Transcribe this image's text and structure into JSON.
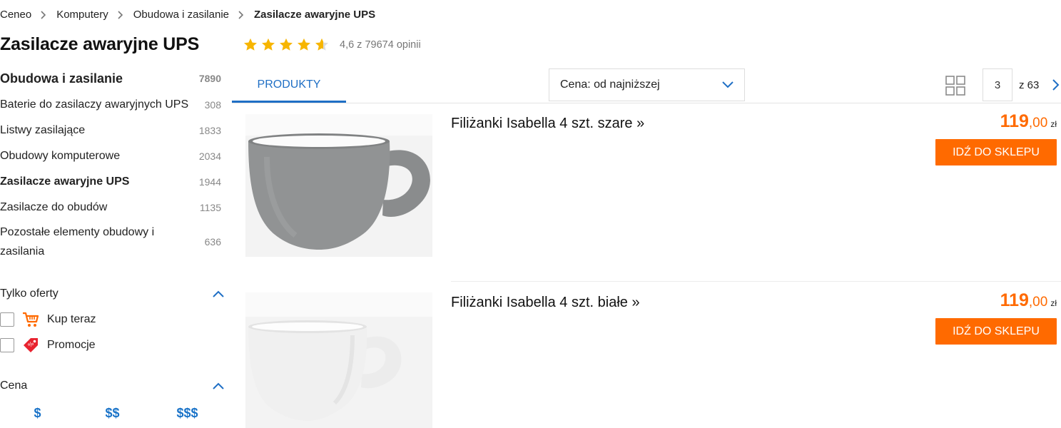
{
  "breadcrumb": {
    "items": [
      "Ceneo",
      "Komputery",
      "Obudowa i zasilanie"
    ],
    "current": "Zasilacze awaryjne UPS"
  },
  "header": {
    "title": "Zasilacze awaryjne UPS",
    "rating_value": 4.6,
    "rating_text": "4,6 z 79674 opinii"
  },
  "sidebar": {
    "parent": {
      "label": "Obudowa i zasilanie",
      "count": "7890"
    },
    "categories": [
      {
        "label": "Baterie do zasilaczy awaryjnych UPS",
        "count": "308"
      },
      {
        "label": "Listwy zasilające",
        "count": "1833"
      },
      {
        "label": "Obudowy komputerowe",
        "count": "2034"
      },
      {
        "label": "Zasilacze awaryjne UPS",
        "count": "1944",
        "active": true
      },
      {
        "label": "Zasilacze do obudów",
        "count": "1135"
      },
      {
        "label": "Pozostałe elementy obudowy i zasilania",
        "count": "636"
      }
    ],
    "offers": {
      "heading": "Tylko oferty",
      "options": [
        {
          "label": "Kup teraz",
          "icon": "cart-icon",
          "checked": false
        },
        {
          "label": "Promocje",
          "icon": "price-tag-icon",
          "checked": false
        }
      ]
    },
    "price": {
      "heading": "Cena",
      "tiers": [
        "$",
        "$$",
        "$$$"
      ]
    }
  },
  "toolbar": {
    "tab_label": "PRODUKTY",
    "sort_label": "Cena: od najniższej",
    "view_icon": "grid-view-icon",
    "page_current": "3",
    "page_total": "z 63"
  },
  "products": [
    {
      "name": "Filiżanki Isabella 4 szt. szare »",
      "price_int": "119",
      "price_dec": ",00",
      "currency": "zł",
      "button": "IDŹ DO SKLEPU",
      "color": "#8f9192"
    },
    {
      "name": "Filiżanki Isabella 4 szt. białe »",
      "price_int": "119",
      "price_dec": ",00",
      "currency": "zł",
      "button": "IDŹ DO SKLEPU",
      "color": "#f4f4f4"
    }
  ],
  "colors": {
    "accent_orange": "#ff6a00",
    "link_blue": "#1f6fc5",
    "star_yellow": "#f7b500"
  }
}
